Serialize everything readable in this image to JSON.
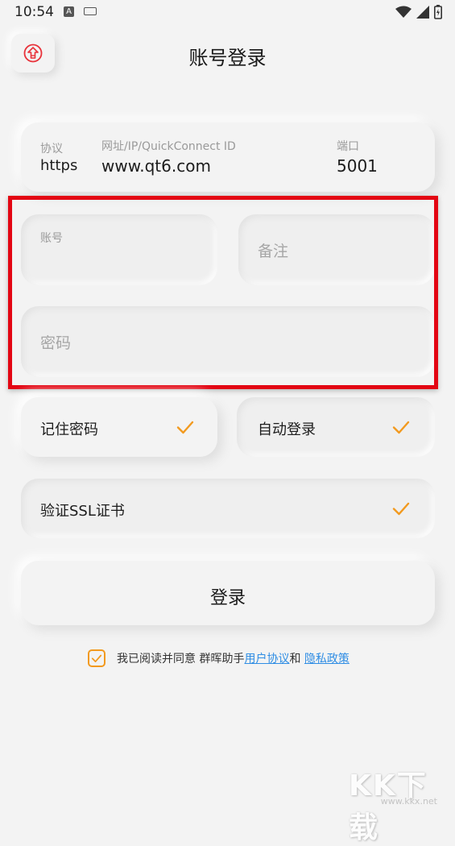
{
  "status_bar": {
    "time": "10:54",
    "a_glyph": "A"
  },
  "header": {
    "title": "账号登录",
    "back_icon": "home-up-arrow-icon"
  },
  "server": {
    "protocol_label": "协议",
    "protocol_value": "https",
    "address_label": "网址/IP/QuickConnect ID",
    "address_value": "www.qt6.com",
    "port_label": "端口",
    "port_value": "5001"
  },
  "credentials": {
    "account_label": "账号",
    "account_value": "",
    "remark_placeholder": "备注",
    "password_placeholder": "密码"
  },
  "options": {
    "remember_password": "记住密码",
    "auto_login": "自动登录",
    "verify_ssl": "验证SSL证书"
  },
  "login_button": "登录",
  "agreement": {
    "prefix": "我已阅读并同意 群晖助手",
    "user_agreement": "用户协议",
    "and": "和",
    "space": " ",
    "privacy_policy": "隐私政策"
  },
  "colors": {
    "accent_orange": "#f29a1f",
    "link_blue": "#2f8de4",
    "highlight_red": "#e30613",
    "back_icon_red": "#e8323a"
  },
  "watermark": {
    "big": "KK下载",
    "small": "www.kkx.net"
  }
}
